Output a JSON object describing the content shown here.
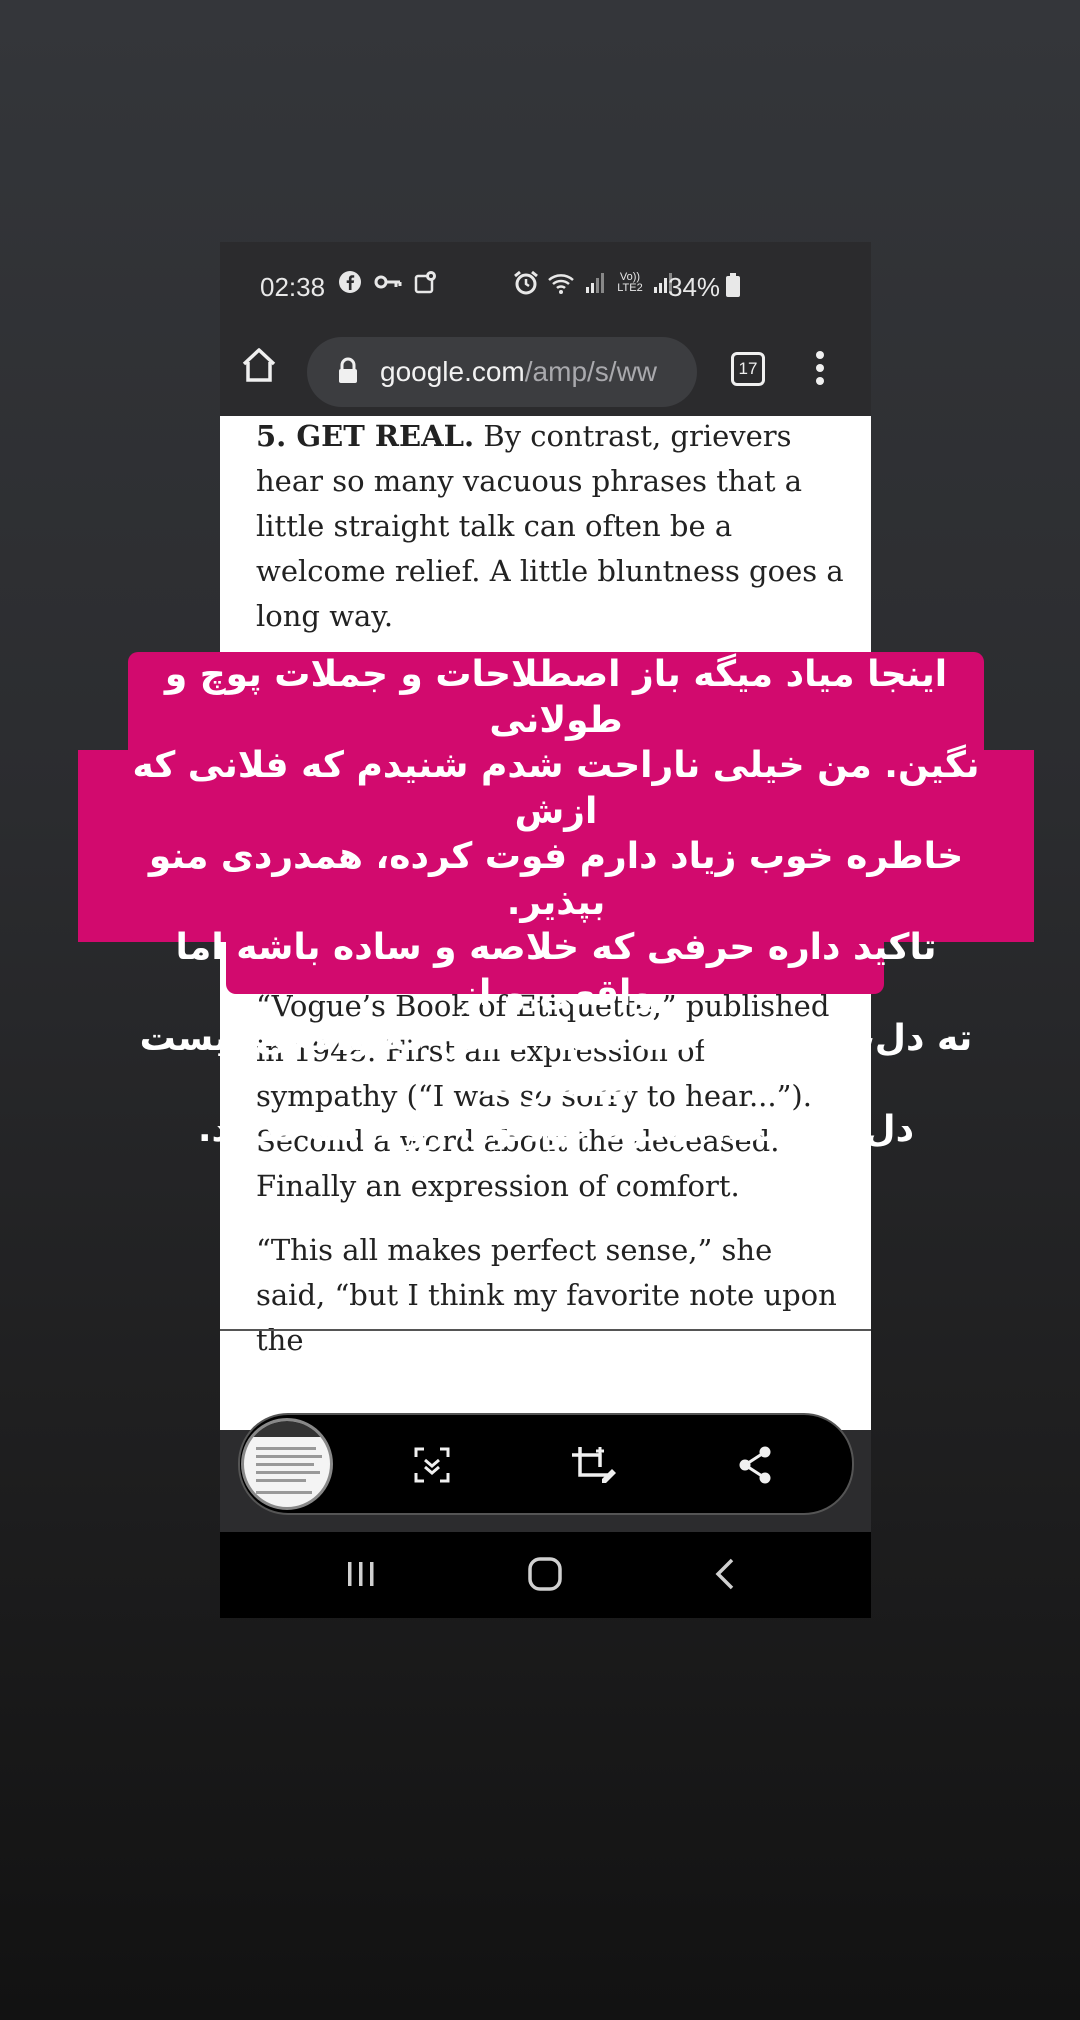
{
  "status_bar": {
    "time": "02:38",
    "signal_label": "Vo)) LTE2",
    "battery": "34%"
  },
  "browser": {
    "url_host": "google.com",
    "url_path": "/amp/s/ww",
    "tab_count": "17"
  },
  "article": {
    "p1_bold": "5. GET REAL.",
    "p1_text": " By contrast, grievers hear so many vacuous phrases that a little straight talk can often be a welcome relief. A little bluntness goes a long way.",
    "p2_text": "“Vogue’s Book of Etiquette,” published in 1948. First an expression of sympathy (“I was so sorry to hear...”). Second a word about the deceased. Finally an expression of comfort.",
    "p3_text": "“This all makes perfect sense,” she said, “but I think my favorite note upon the"
  },
  "overlay_caption": {
    "line1": "اینجا میاد میگه باز اصطلاحات و جملات پوچ و طولانی",
    "line2": "نگین. من خیلی ناراحت شدم شنیدم که فلانی که ازش",
    "line3": "خاطره خوب زیاد دارم فوت کرده، همدردی منو بپذیر.",
    "line4": "تاکید داره حرفی که خلاصه و ساده باشه اما واقعی و از",
    "line5": "ته دل، از دو ساعت قصه گفتن که واقعی نیست بیشتر به",
    "line6": "دل میشینه، بیخود خودتون رو اذیت نکنید.",
    "color": "#d20a6e"
  },
  "screenshot_toolbar": {
    "icons": [
      "screenshot-thumbnail",
      "scroll-capture-icon",
      "crop-edit-icon",
      "share-icon"
    ]
  },
  "nav_bar": {
    "icons": [
      "recent-apps-icon",
      "home-icon",
      "back-icon"
    ]
  }
}
